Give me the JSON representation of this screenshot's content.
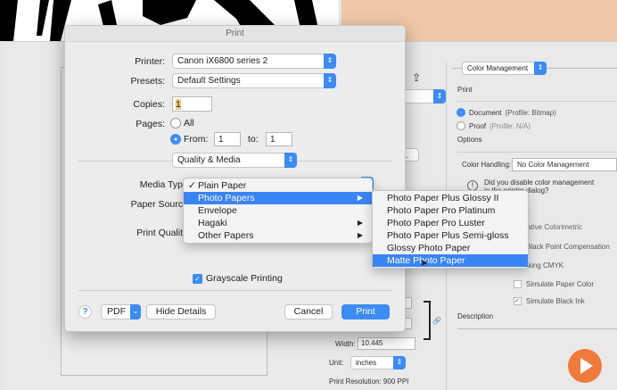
{
  "dialog": {
    "title": "Print",
    "printer_label": "Printer:",
    "printer_value": "Canon iX6800 series 2",
    "presets_label": "Presets:",
    "presets_value": "Default Settings",
    "copies_label": "Copies:",
    "copies_value": "1",
    "pages_label": "Pages:",
    "all_label": "All",
    "from_label": "From:",
    "from_value": "1",
    "to_label": "to:",
    "to_value": "1",
    "section_value": "Quality & Media",
    "media_type_label": "Media Typ",
    "paper_source_label": "Paper Sourc",
    "print_quality_label": "Print Qualit",
    "grayscale_label": "Grayscale Printing",
    "grayscale_checked": true,
    "help": "?",
    "pdf_label": "PDF",
    "hide_details": "Hide Details",
    "cancel": "Cancel",
    "print": "Print",
    "pages_mode": "from"
  },
  "media_menu": {
    "items": [
      {
        "label": "Plain Paper",
        "checked": true
      },
      {
        "label": "Photo Papers",
        "highlighted": true,
        "submenu": true
      },
      {
        "label": "Envelope"
      },
      {
        "label": "Hagaki",
        "submenu": true
      },
      {
        "label": "Other Papers",
        "submenu": true
      }
    ]
  },
  "photo_submenu": {
    "items": [
      "Photo Paper Plus Glossy II",
      "Photo Paper Pro Platinum",
      "Photo Paper Pro Luster",
      "Photo Paper Plus Semi-gloss",
      "Glossy Photo Paper",
      "Matte Photo Paper"
    ],
    "highlighted": "Matte Photo Paper"
  },
  "ps_panel": {
    "color_management": "Color Management",
    "print_heading": "Print",
    "document_label": "Document",
    "document_profile": "(Profile: Bitmap)",
    "proof_label": "Proof",
    "proof_profile": "(Profile: N/A)",
    "options_heading": "Options",
    "color_handling_label": "Color Handling:",
    "color_handling_value": "No Color Management",
    "warning": "Did you disable color management",
    "warning2": "in the printer dialog?",
    "rendering": "elative Colorimetric",
    "bpc": "Black Point Compensation",
    "proof_setup": "orking CMYK",
    "simulate_paper": "Simulate Paper Color",
    "simulate_ink": "Simulate Black Ink",
    "description": "Description",
    "width_label": "Width:",
    "width_value": "10.445",
    "unit_label": "Unit:",
    "unit_value": "inches",
    "resolution": "Print Resolution: 900 PPI",
    "ellipsis": "..."
  },
  "colors": {
    "accent": "#3a85f5",
    "play": "#f07a3c",
    "peach": "#f0c8a8"
  }
}
